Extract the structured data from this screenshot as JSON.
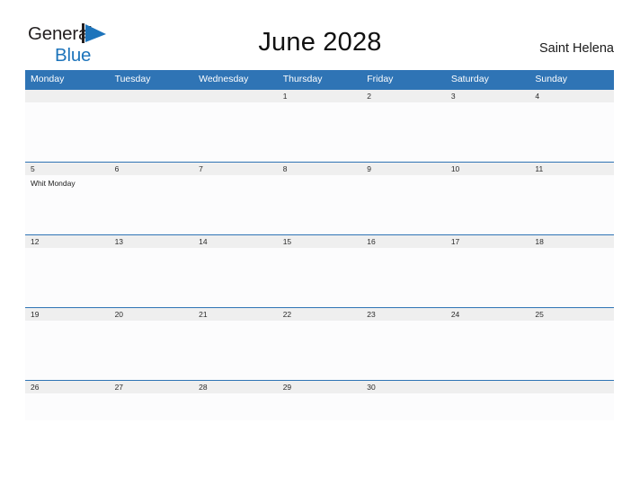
{
  "brand": {
    "name_line1": "General",
    "name_line2": "Blue",
    "mark": "flag-triangle-icon",
    "color_dark": "#231f20",
    "color_blue": "#1d74bb"
  },
  "header": {
    "title": "June 2028",
    "region": "Saint Helena"
  },
  "theme": {
    "header_blue": "#2f74b5",
    "datebar_gray": "#efefef",
    "cell_background": "#fcfcfd",
    "page_background": "#ffffff"
  },
  "calendar": {
    "month": "June",
    "year": "2028",
    "weekday_headers": [
      "Monday",
      "Tuesday",
      "Wednesday",
      "Thursday",
      "Friday",
      "Saturday",
      "Sunday"
    ],
    "weeks": [
      [
        {
          "day": "",
          "events": []
        },
        {
          "day": "",
          "events": []
        },
        {
          "day": "",
          "events": []
        },
        {
          "day": "1",
          "events": []
        },
        {
          "day": "2",
          "events": []
        },
        {
          "day": "3",
          "events": []
        },
        {
          "day": "4",
          "events": []
        }
      ],
      [
        {
          "day": "5",
          "events": [
            "Whit Monday"
          ]
        },
        {
          "day": "6",
          "events": []
        },
        {
          "day": "7",
          "events": []
        },
        {
          "day": "8",
          "events": []
        },
        {
          "day": "9",
          "events": []
        },
        {
          "day": "10",
          "events": []
        },
        {
          "day": "11",
          "events": []
        }
      ],
      [
        {
          "day": "12",
          "events": []
        },
        {
          "day": "13",
          "events": []
        },
        {
          "day": "14",
          "events": []
        },
        {
          "day": "15",
          "events": []
        },
        {
          "day": "16",
          "events": []
        },
        {
          "day": "17",
          "events": []
        },
        {
          "day": "18",
          "events": []
        }
      ],
      [
        {
          "day": "19",
          "events": []
        },
        {
          "day": "20",
          "events": []
        },
        {
          "day": "21",
          "events": []
        },
        {
          "day": "22",
          "events": []
        },
        {
          "day": "23",
          "events": []
        },
        {
          "day": "24",
          "events": []
        },
        {
          "day": "25",
          "events": []
        }
      ],
      [
        {
          "day": "26",
          "events": []
        },
        {
          "day": "27",
          "events": []
        },
        {
          "day": "28",
          "events": []
        },
        {
          "day": "29",
          "events": []
        },
        {
          "day": "30",
          "events": []
        },
        {
          "day": "",
          "events": []
        },
        {
          "day": "",
          "events": []
        }
      ]
    ]
  }
}
